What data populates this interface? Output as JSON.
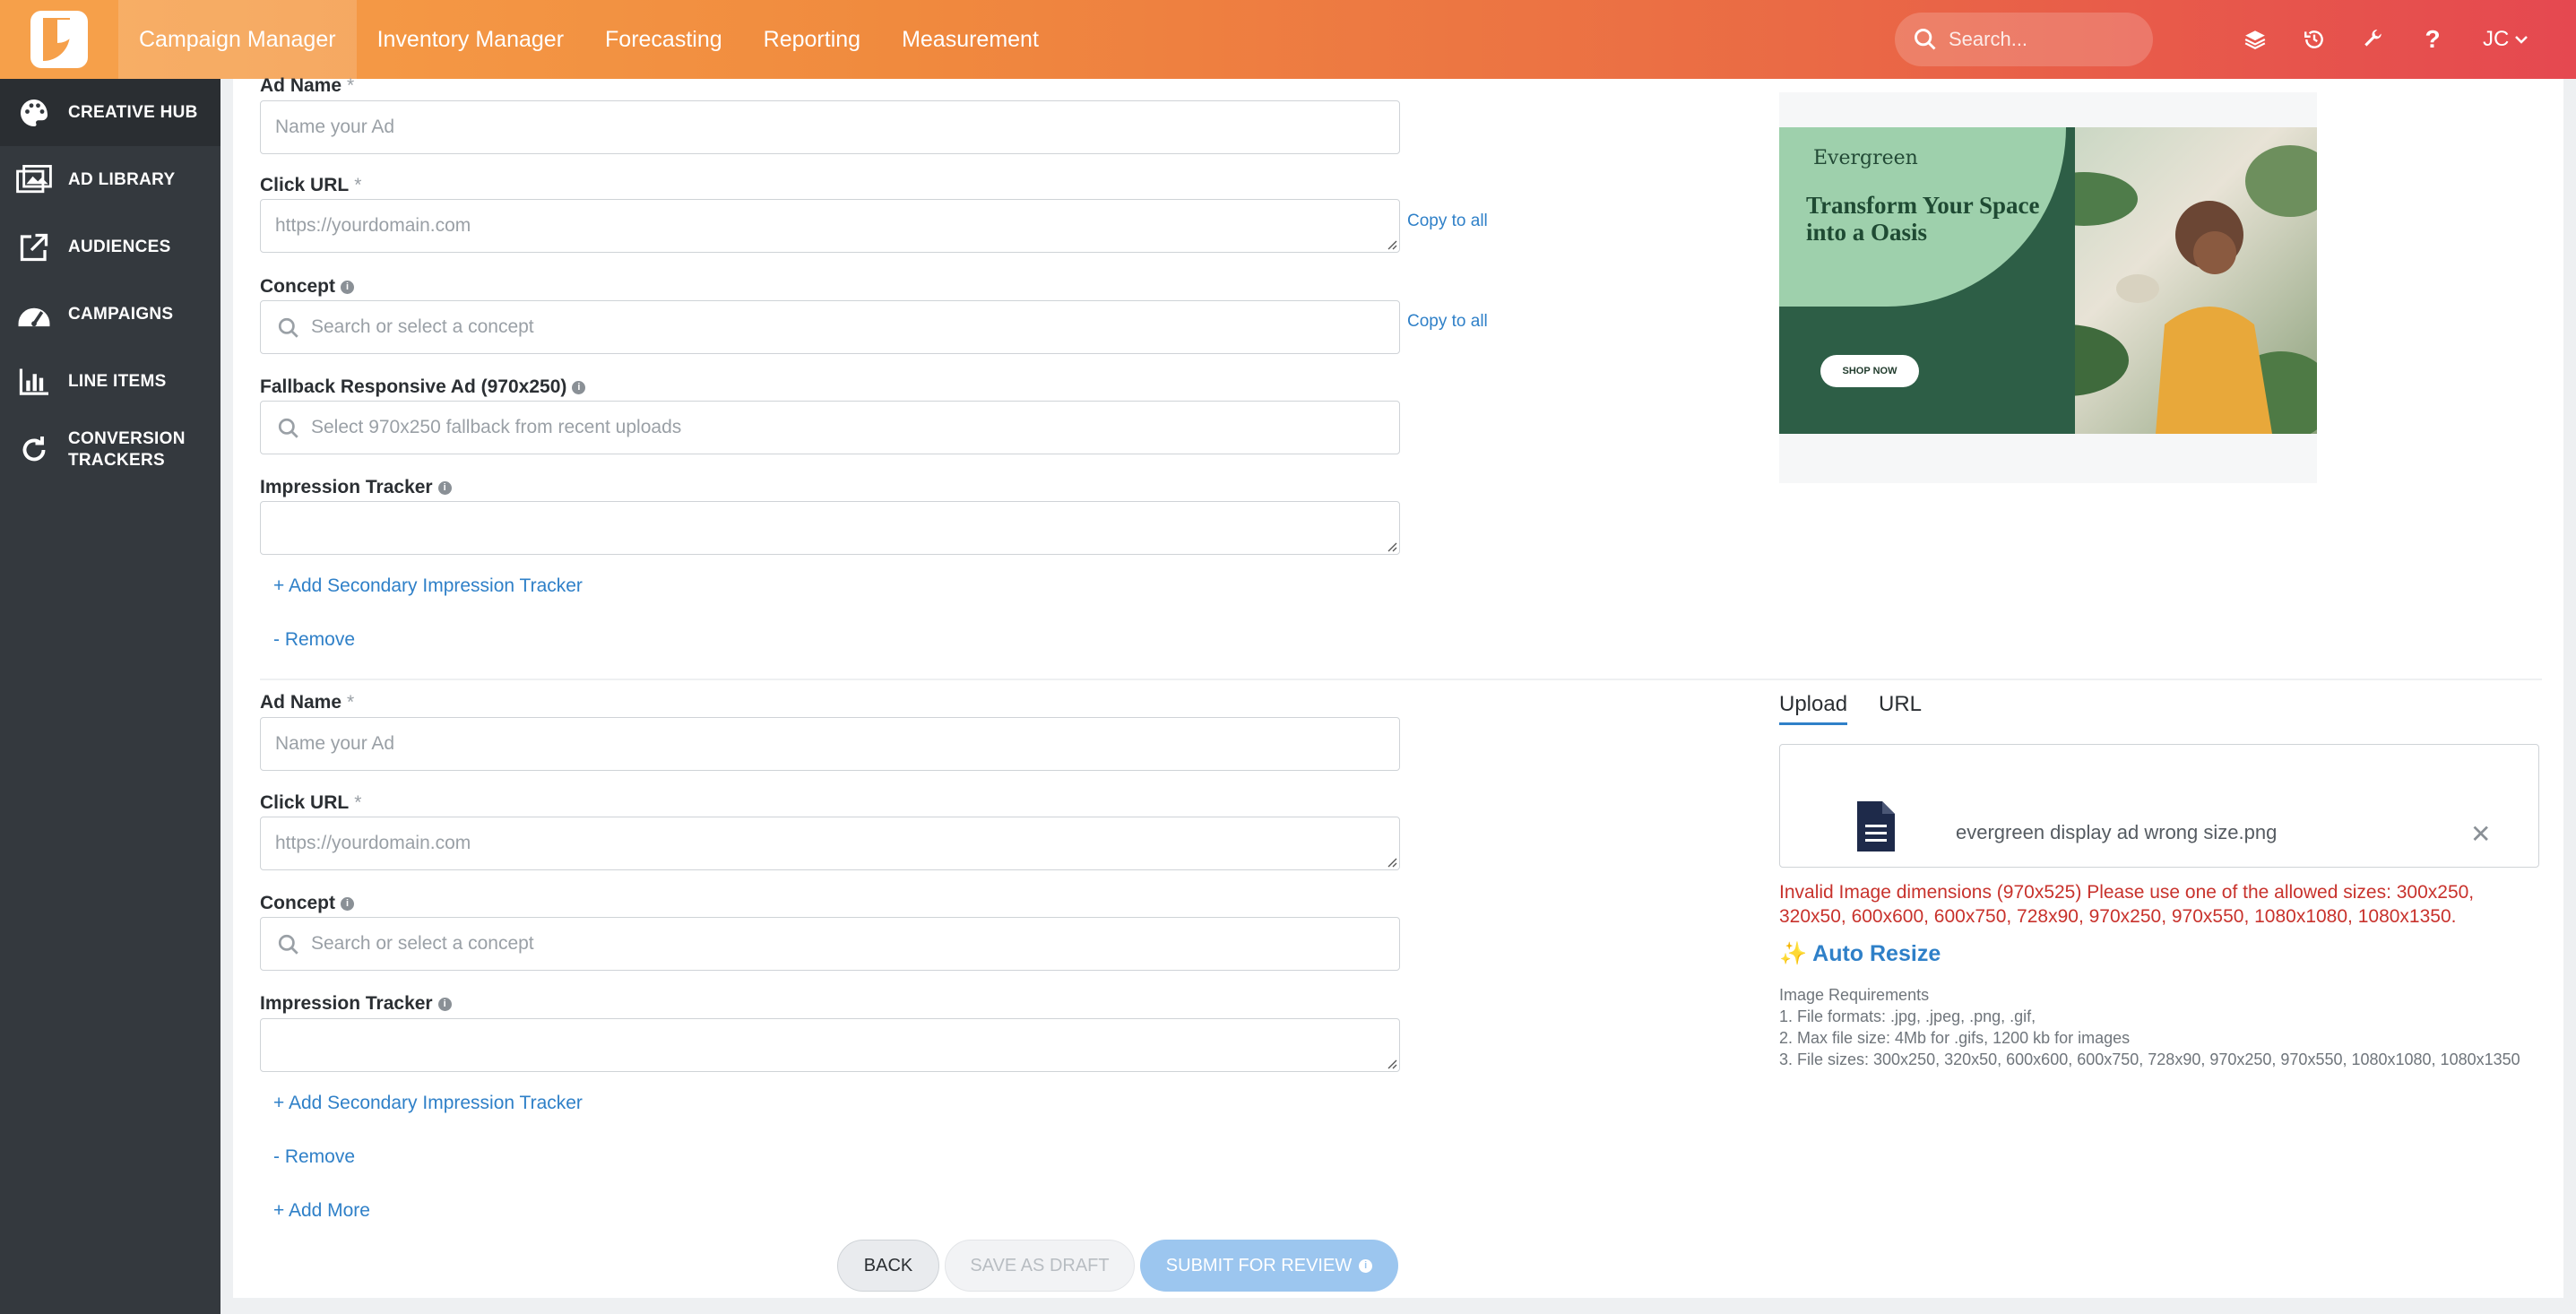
{
  "nav": {
    "items": [
      "Campaign Manager",
      "Inventory Manager",
      "Forecasting",
      "Reporting",
      "Measurement"
    ],
    "search_placeholder": "Search...",
    "user_initials": "JC"
  },
  "sidebar": {
    "items": [
      {
        "label": "CREATIVE HUB",
        "icon": "palette-icon"
      },
      {
        "label": "AD LIBRARY",
        "icon": "image-library-icon"
      },
      {
        "label": "AUDIENCES",
        "icon": "external-link-icon"
      },
      {
        "label": "CAMPAIGNS",
        "icon": "dashboard-icon"
      },
      {
        "label": "LINE ITEMS",
        "icon": "bar-chart-icon"
      },
      {
        "label": "CONVERSION TRACKERS",
        "icon": "refresh-icon"
      }
    ]
  },
  "ad1": {
    "ad_name_label": "Ad Name",
    "ad_name_placeholder": "Name your Ad",
    "click_url_label": "Click URL",
    "click_url_placeholder": "https://yourdomain.com",
    "concept_label": "Concept",
    "concept_placeholder": "Search or select a concept",
    "fallback_label": "Fallback Responsive Ad (970x250)",
    "fallback_placeholder": "Select 970x250 fallback from recent uploads",
    "impression_label": "Impression Tracker",
    "add_secondary": "+ Add Secondary Impression Tracker",
    "remove": "- Remove",
    "copy_to_all": "Copy to all"
  },
  "preview": {
    "brand": "Evergreen",
    "headline": "Transform Your Space into a Oasis",
    "cta": "SHOP NOW"
  },
  "ad2": {
    "ad_name_label": "Ad Name",
    "ad_name_placeholder": "Name your Ad",
    "click_url_label": "Click URL",
    "click_url_placeholder": "https://yourdomain.com",
    "concept_label": "Concept",
    "concept_placeholder": "Search or select a concept",
    "impression_label": "Impression Tracker",
    "add_secondary": "+ Add Secondary Impression Tracker",
    "remove": "- Remove",
    "add_more": "+ Add More"
  },
  "upload": {
    "tabs": [
      "Upload",
      "URL"
    ],
    "file_name": "evergreen display ad wrong size.png",
    "error": "Invalid Image dimensions (970x525) Please use one of the allowed sizes: 300x250, 320x50, 600x600, 600x750, 728x90, 970x250, 970x550, 1080x1080, 1080x1350.",
    "auto_resize": "Auto Resize",
    "requirements_title": "Image Requirements",
    "requirements": [
      "1. File formats: .jpg, .jpeg, .png, .gif,",
      "2. Max file size: 4Mb for .gifs, 1200 kb for images",
      "3. File sizes: 300x250, 320x50, 600x600, 600x750, 728x90, 970x250, 970x550, 1080x1080, 1080x1350"
    ]
  },
  "footer": {
    "back": "BACK",
    "save_draft": "SAVE AS DRAFT",
    "submit": "SUBMIT FOR REVIEW"
  },
  "colors": {
    "accent": "#2f80c8",
    "error": "#c8322c",
    "sidebar": "#34393e"
  }
}
